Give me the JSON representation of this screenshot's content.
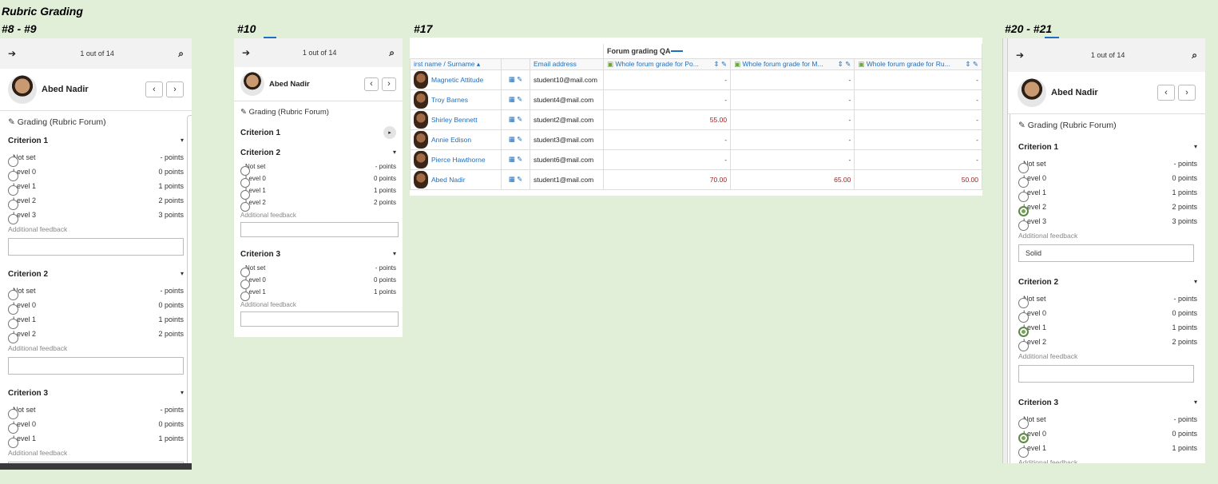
{
  "page": {
    "title": "Rubric Grading",
    "labels": {
      "a": "#8 - #9",
      "b": "#10",
      "c": "#17",
      "d": "#20 - #21"
    }
  },
  "grader": {
    "counter": "1 out of 14",
    "user": "Abed Nadir",
    "title": "Grading (Rubric Forum)",
    "feedback_label": "Additional feedback"
  },
  "panel_a": {
    "criteria": [
      {
        "name": "Criterion 1",
        "levels": [
          {
            "l": "Not set",
            "p": "- points"
          },
          {
            "l": "Level 0",
            "p": "0 points"
          },
          {
            "l": "Level 1",
            "p": "1 points"
          },
          {
            "l": "Level 2",
            "p": "2 points"
          },
          {
            "l": "Level 3",
            "p": "3 points"
          }
        ]
      },
      {
        "name": "Criterion 2",
        "levels": [
          {
            "l": "Not set",
            "p": "- points"
          },
          {
            "l": "Level 0",
            "p": "0 points"
          },
          {
            "l": "Level 1",
            "p": "1 points"
          },
          {
            "l": "Level 2",
            "p": "2 points"
          }
        ]
      },
      {
        "name": "Criterion 3",
        "levels": [
          {
            "l": "Not set",
            "p": "- points"
          },
          {
            "l": "Level 0",
            "p": "0 points"
          },
          {
            "l": "Level 1",
            "p": "1 points"
          }
        ]
      }
    ]
  },
  "panel_b": {
    "c1": "Criterion 1",
    "c2": "Criterion 2",
    "c2_levels": [
      {
        "l": "Not set",
        "p": "- points"
      },
      {
        "l": "Level 0",
        "p": "0 points"
      },
      {
        "l": "Level 1",
        "p": "1 points"
      },
      {
        "l": "Level 2",
        "p": "2 points"
      }
    ],
    "c3": "Criterion 3",
    "c3_levels": [
      {
        "l": "Not set",
        "p": "- points"
      },
      {
        "l": "Level 0",
        "p": "0 points"
      },
      {
        "l": "Level 1",
        "p": "1 points"
      }
    ]
  },
  "panel_d": {
    "c1_feedback": "Solid"
  },
  "table": {
    "group": "Forum grading QA",
    "col_name": "irst name / Surname",
    "col_email": "Email address",
    "col_g1": "Whole forum grade for Po...",
    "col_g2": "Whole forum grade for M...",
    "col_g3": "Whole forum grade for Ru...",
    "rows": [
      {
        "name": "Magnetic Attitude",
        "email": "student10@mail.com",
        "g1": "-",
        "g2": "-",
        "g3": "-"
      },
      {
        "name": "Troy Barnes",
        "email": "student4@mail.com",
        "g1": "-",
        "g2": "-",
        "g3": "-"
      },
      {
        "name": "Shirley Bennett",
        "email": "student2@mail.com",
        "g1": "55.00",
        "g2": "-",
        "g3": "-"
      },
      {
        "name": "Annie Edison",
        "email": "student3@mail.com",
        "g1": "-",
        "g2": "-",
        "g3": "-"
      },
      {
        "name": "Pierce Hawthorne",
        "email": "student6@mail.com",
        "g1": "-",
        "g2": "-",
        "g3": "-"
      },
      {
        "name": "Abed Nadir",
        "email": "student1@mail.com",
        "g1": "70.00",
        "g2": "65.00",
        "g3": "50.00"
      }
    ]
  }
}
